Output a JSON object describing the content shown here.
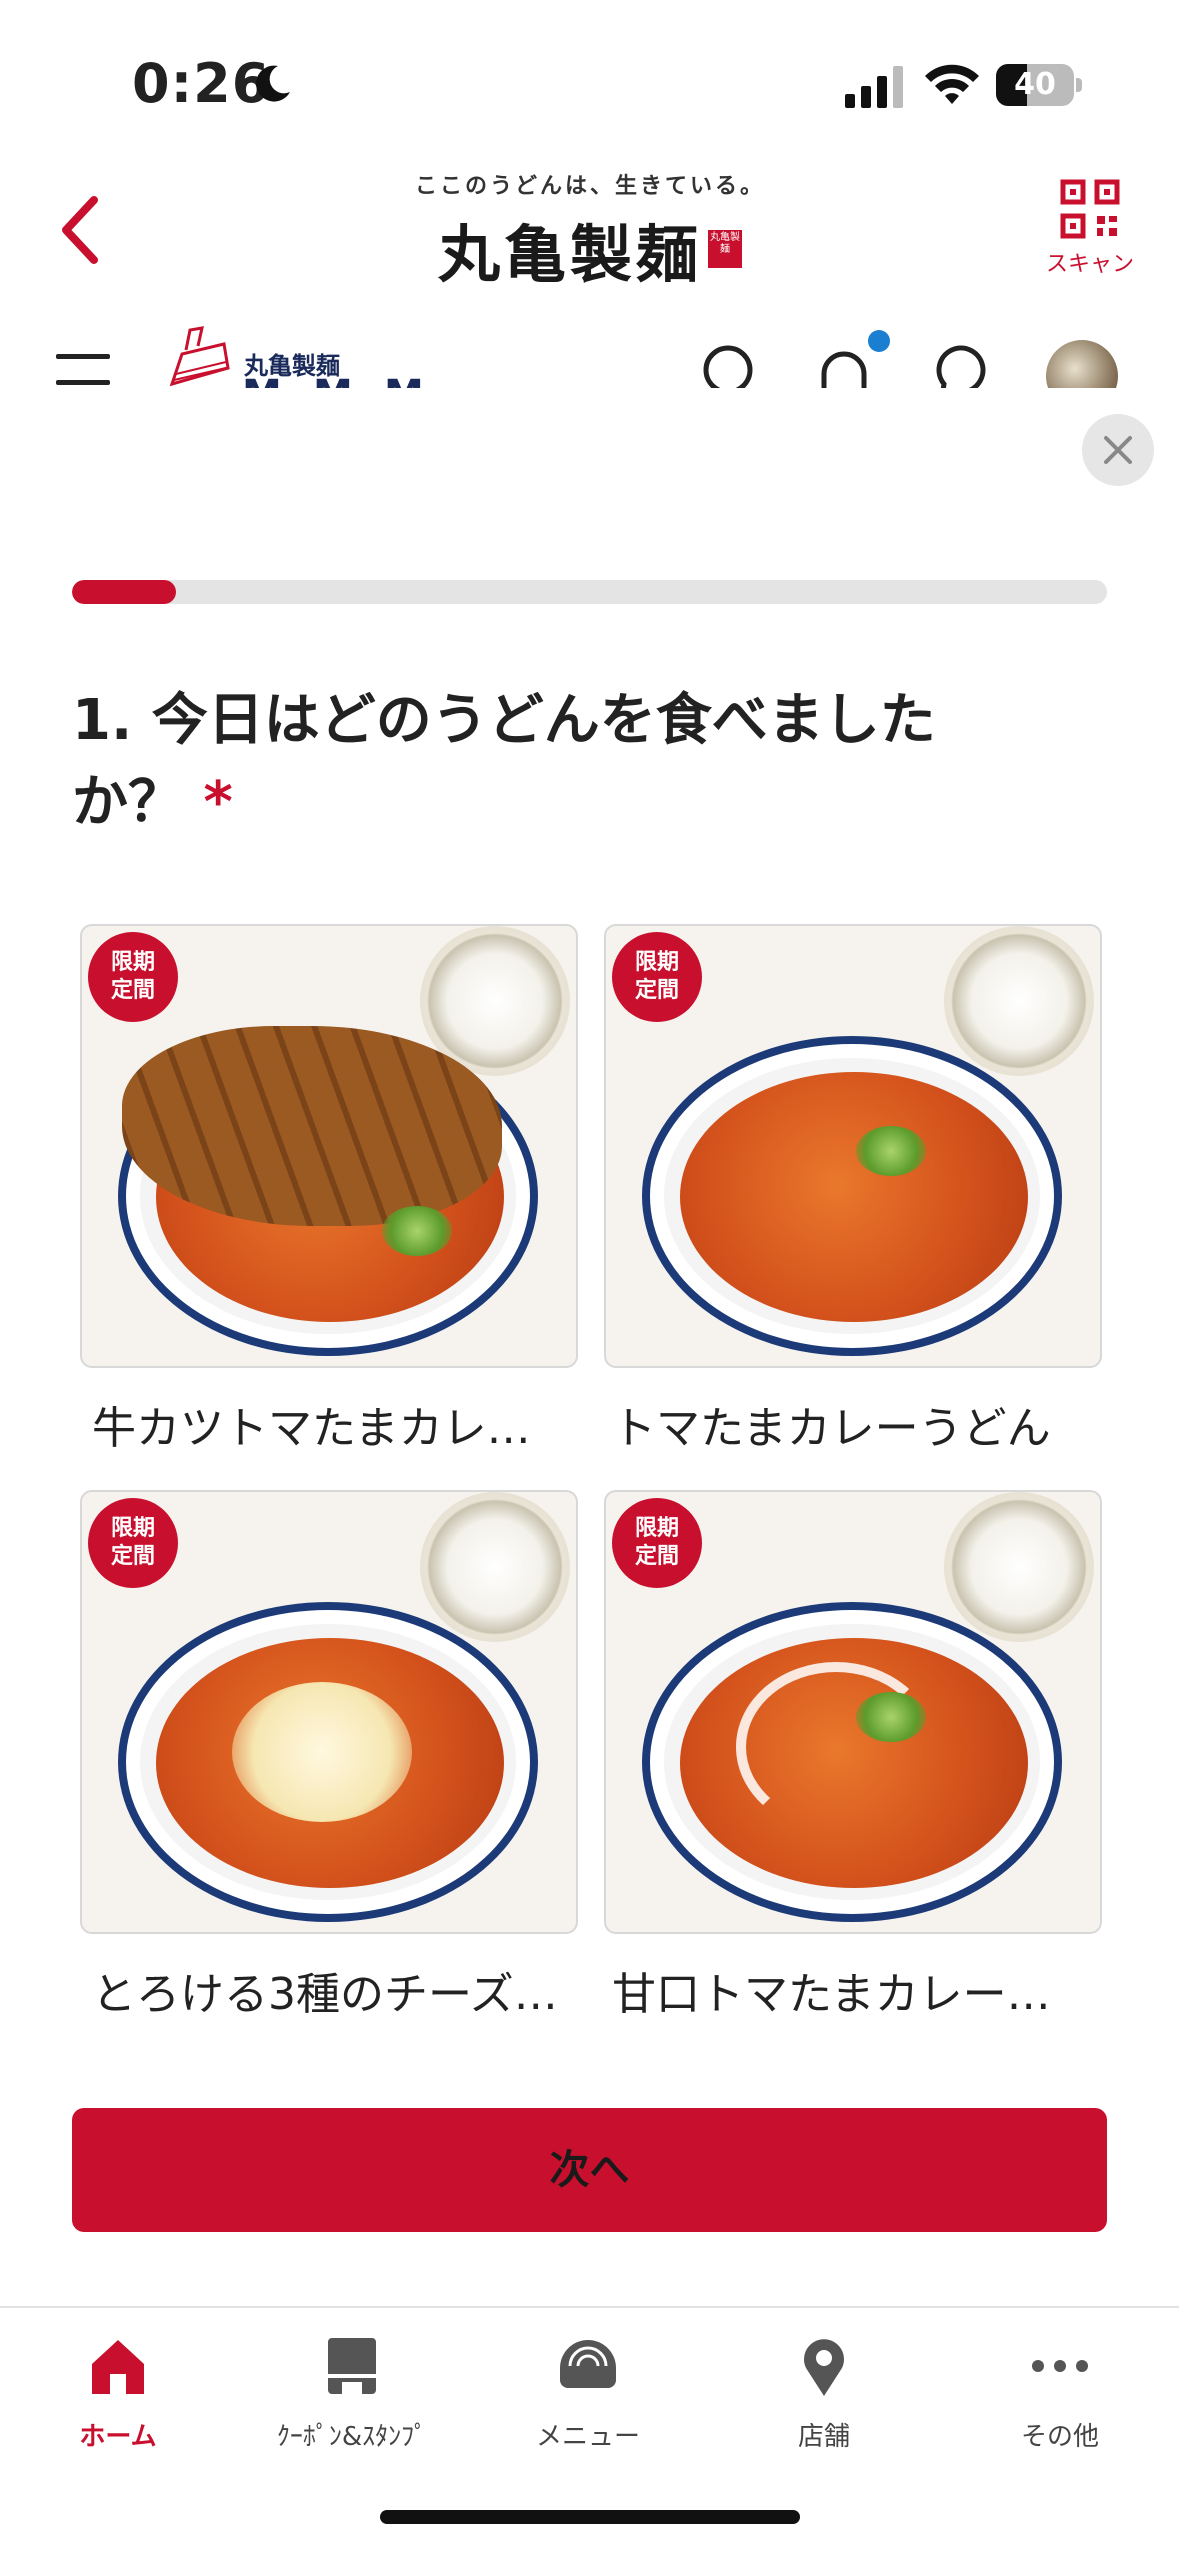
{
  "status_bar": {
    "time": "0:26",
    "battery_level": "40",
    "battery_fraction": 0.4
  },
  "header": {
    "logo_tagline": "ここのうどんは、生きている。",
    "logo_name": "丸亀製麺",
    "logo_seal": "丸亀製麺",
    "scan_label": "スキャン"
  },
  "subnav": {
    "mm_logo_text": "丸亀製麺",
    "has_notification": true
  },
  "survey": {
    "progress_fraction": 0.1,
    "question": "1. 今日はどのうどんを食べましたか？",
    "required_mark": "*",
    "options": [
      {
        "label": "牛カツトマたまカレ…",
        "badge": "限期\n定間",
        "style": "cutlet"
      },
      {
        "label": "トマたまカレーうどん",
        "badge": "限期\n定間",
        "style": "plain"
      },
      {
        "label": "とろける3種のチーズ…",
        "badge": "限期\n定間",
        "style": "cheese"
      },
      {
        "label": "甘口トマたまカレー…",
        "badge": "限期\n定間",
        "style": "cream"
      }
    ],
    "next_label": "次へ"
  },
  "tabbar": {
    "tabs": [
      {
        "label": "ホーム",
        "icon": "home-icon",
        "active": true
      },
      {
        "label": "ｸｰﾎﾟﾝ&ｽﾀﾝﾌﾟ",
        "icon": "coupon-icon",
        "active": false
      },
      {
        "label": "メニュー",
        "icon": "menu-bowl-icon",
        "active": false
      },
      {
        "label": "店舗",
        "icon": "location-pin-icon",
        "active": false
      },
      {
        "label": "その他",
        "icon": "more-icon",
        "active": false
      }
    ]
  },
  "colors": {
    "brand_red": "#c8102e",
    "notification_blue": "#1a7fd0",
    "nav_navy": "#1a2a5a"
  }
}
